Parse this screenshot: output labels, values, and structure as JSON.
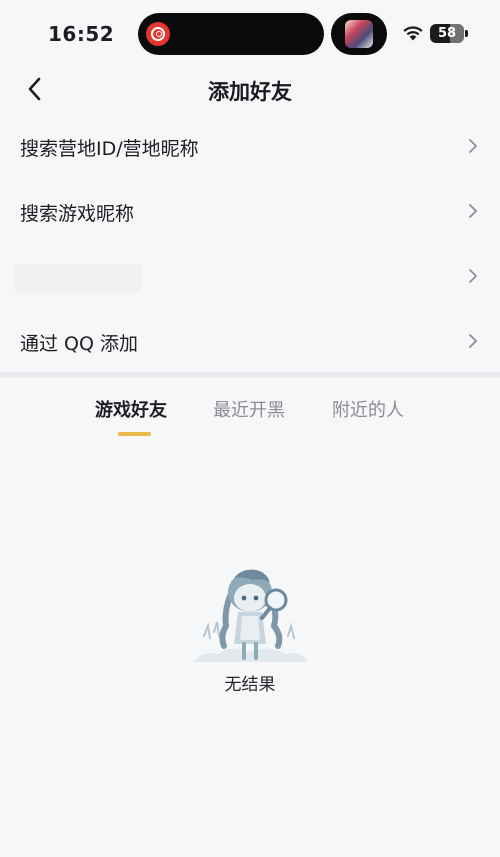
{
  "status_bar": {
    "time": "16:52",
    "battery": "58",
    "battery_level": 0.58
  },
  "header": {
    "title": "添加好友"
  },
  "menu": {
    "items": [
      {
        "label": "搜索营地ID/营地昵称"
      },
      {
        "label": "搜索游戏昵称"
      },
      {
        "label": ""
      },
      {
        "label": "通过 QQ 添加"
      }
    ]
  },
  "tabs": [
    {
      "label": "游戏好友",
      "active": true
    },
    {
      "label": "最近开黑",
      "active": false
    },
    {
      "label": "附近的人",
      "active": false
    }
  ],
  "empty_state": {
    "text": "无结果"
  },
  "colors": {
    "accent": "#e9b94a",
    "background": "#f6f7f9",
    "island_app": "#e5352f"
  }
}
